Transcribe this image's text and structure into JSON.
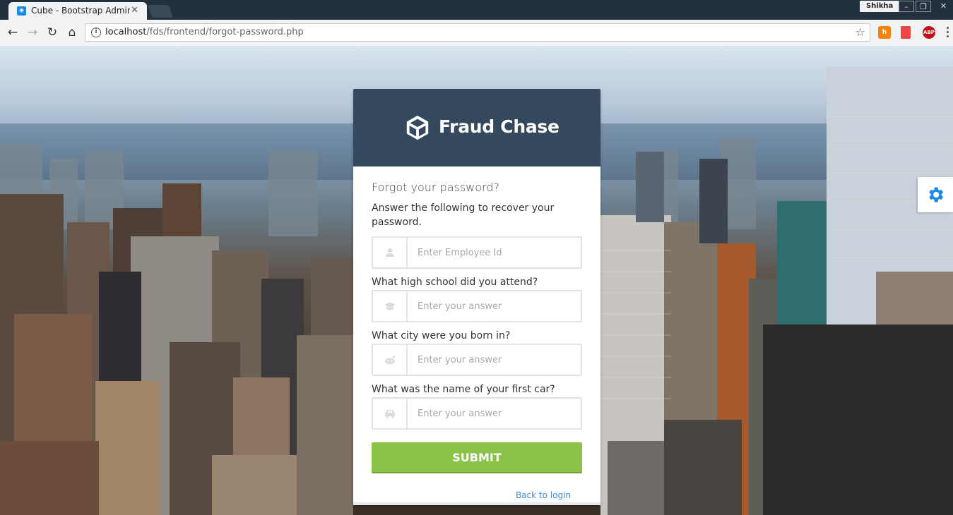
{
  "browser": {
    "tab_title": "Cube - Bootstrap Admin",
    "profile_name": "Shikha",
    "url_host": "localhost",
    "url_path": "/fds/frontend/forgot-password.php",
    "extensions": [
      "hubspot-icon",
      "bookmark-icon",
      "adblock-icon"
    ],
    "adblock_label": "ABP"
  },
  "login": {
    "brand": "Fraud Chase",
    "title": "Forgot your password?",
    "subtitle": "Answer the following to recover your password.",
    "employee_placeholder": "Enter Employee Id",
    "questions": [
      {
        "label": "What high school did you attend?",
        "placeholder": "Enter your answer",
        "icon": "graduation-cap-icon"
      },
      {
        "label": "What city were you born in?",
        "placeholder": "Enter your answer",
        "icon": "reddit-icon"
      },
      {
        "label": "What was the name of your first car?",
        "placeholder": "Enter your answer",
        "icon": "car-icon"
      }
    ],
    "submit_label": "SUBMIT",
    "back_link": "Back to login"
  },
  "colors": {
    "header": "#34495e",
    "submit": "#8bc34a",
    "link": "#3e8ee0",
    "settings_gear": "#1e88e5"
  }
}
